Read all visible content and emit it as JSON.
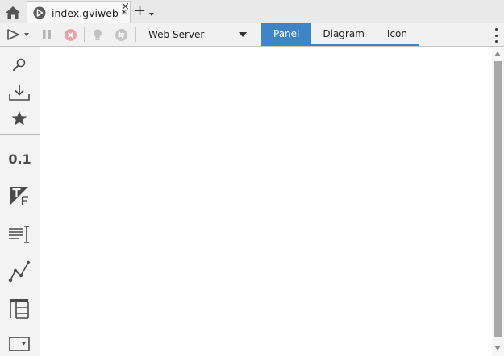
{
  "tabs": {
    "home_icon": "home-icon",
    "document": {
      "icon": "run-circle-icon",
      "label": "index.gviweb *",
      "close": "×"
    },
    "add_label": "+"
  },
  "toolbar": {
    "run_icon": "play-icon",
    "pause_icon": "pause-icon",
    "stop_icon": "stop-icon",
    "hint_icon": "lightbulb-icon",
    "hash_icon": "hash-icon",
    "server_select": {
      "value": "Web Server"
    },
    "view_tabs": [
      {
        "label": "Panel",
        "active": true
      },
      {
        "label": "Diagram",
        "active": false
      },
      {
        "label": "Icon",
        "active": false
      }
    ]
  },
  "palette": {
    "items": [
      "search-icon",
      "download-icon",
      "star-icon",
      "numeric-control-icon",
      "boolean-tf-icon",
      "string-control-icon",
      "graph-icon",
      "table-icon",
      "dropdown-icon"
    ],
    "numeric_label": "0.1"
  },
  "colors": {
    "accent": "#3d85c6",
    "toolbar_bg": "#f1f1f1",
    "palette_bg": "#f3f3f3"
  }
}
